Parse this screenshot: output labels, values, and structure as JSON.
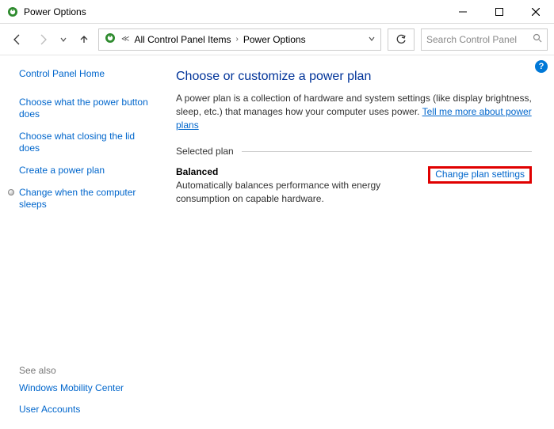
{
  "window": {
    "title": "Power Options"
  },
  "breadcrumb": {
    "item1": "All Control Panel Items",
    "item2": "Power Options"
  },
  "search": {
    "placeholder": "Search Control Panel"
  },
  "sidebar": {
    "home": "Control Panel Home",
    "links": [
      "Choose what the power button does",
      "Choose what closing the lid does",
      "Create a power plan",
      "Change when the computer sleeps"
    ],
    "see_also_hdr": "See also",
    "see_also": [
      "Windows Mobility Center",
      "User Accounts"
    ]
  },
  "main": {
    "heading": "Choose or customize a power plan",
    "description_a": "A power plan is a collection of hardware and system settings (like display brightness, sleep, etc.) that manages how your computer uses power. ",
    "description_link": "Tell me more about power plans",
    "section_label": "Selected plan",
    "plan": {
      "name": "Balanced",
      "desc": "Automatically balances performance with energy consumption on capable hardware.",
      "change_link": "Change plan settings"
    }
  },
  "help": "?"
}
